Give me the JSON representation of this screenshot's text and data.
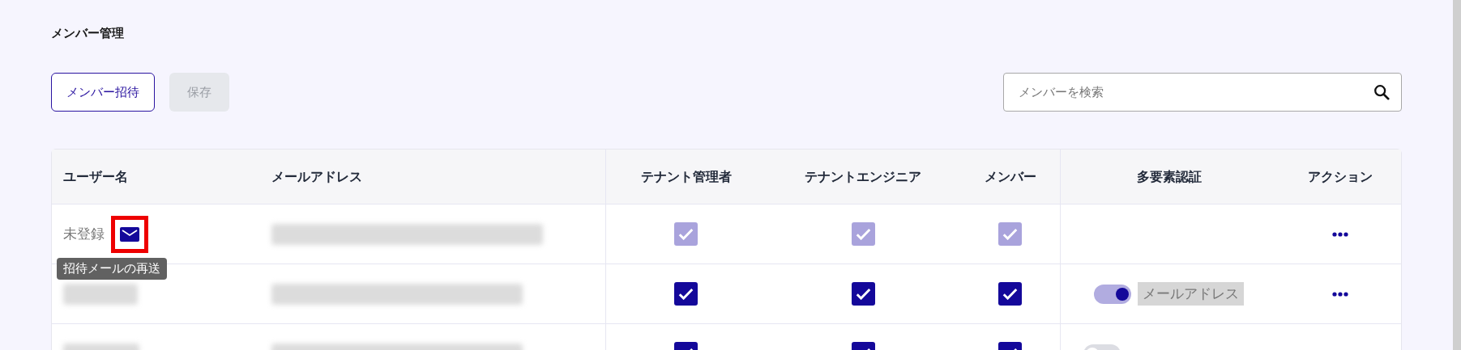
{
  "page_title": "メンバー管理",
  "buttons": [
    {
      "label": "メンバー招待",
      "disabled": false
    },
    {
      "label": "保存",
      "disabled": true
    }
  ],
  "search": {
    "placeholder": "メンバーを検索"
  },
  "table": {
    "columns": [
      "ユーザー名",
      "メールアドレス",
      "テナント管理者",
      "テナントエンジニア",
      "メンバー",
      "多要素認証",
      "アクション"
    ],
    "rows": [
      {
        "name": {
          "kind": "text",
          "text": "未登録"
        },
        "resend": {
          "highlighted": true,
          "tooltip": "招待メールの再送"
        },
        "email": {
          "kind": "redacted"
        },
        "roles": [
          {
            "checked": true,
            "disabled": true
          },
          {
            "checked": true,
            "disabled": true
          },
          {
            "checked": true,
            "disabled": true
          }
        ],
        "menu": true
      },
      {
        "name": {
          "kind": "redacted"
        },
        "email": {
          "kind": "redacted"
        },
        "roles": [
          {
            "checked": true,
            "disabled": false
          },
          {
            "checked": true,
            "disabled": false
          },
          {
            "checked": true,
            "disabled": false
          }
        ],
        "mfa": {
          "on": true,
          "label": "メールアドレス"
        },
        "menu": true
      },
      {
        "name": {
          "kind": "redacted"
        },
        "email": {
          "kind": "redacted"
        },
        "roles": [
          {
            "checked": true,
            "disabled": false
          },
          {
            "checked": true,
            "disabled": false
          },
          {
            "checked": true,
            "disabled": false
          }
        ],
        "mfa": {
          "on": false
        }
      }
    ]
  }
}
